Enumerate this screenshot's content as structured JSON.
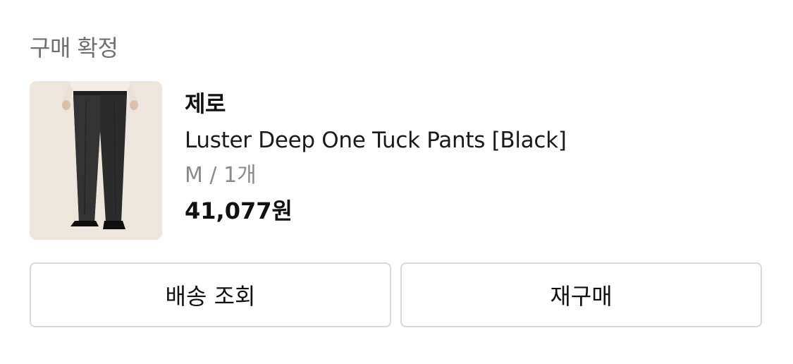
{
  "order": {
    "status": "구매 확정",
    "product": {
      "image_icon": "pants-product-image",
      "brand": "제로",
      "name": "Luster Deep One Tuck Pants [Black]",
      "option": "M / 1개",
      "price": "41,077원"
    },
    "actions": {
      "track_shipping_label": "배송 조회",
      "repurchase_label": "재구매"
    }
  },
  "colors": {
    "background": "#ffffff",
    "text_primary": "#111111",
    "text_secondary": "#8a8a8a",
    "button_border": "#d9d9d9",
    "thumb_background": "#ece6dc"
  }
}
